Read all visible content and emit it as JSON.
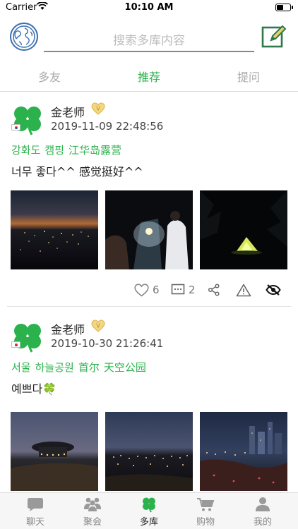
{
  "status_bar": {
    "carrier": "Carrier",
    "time": "10:10 AM"
  },
  "header": {
    "search_placeholder": "搜索多库内容"
  },
  "tabs": [
    {
      "label": "多友"
    },
    {
      "label": "推荐"
    },
    {
      "label": "提问"
    }
  ],
  "posts": [
    {
      "username": "金老师",
      "timestamp": "2019-11-09 22:48:56",
      "tags": [
        "강화도",
        "캠핑",
        "江华岛露营"
      ],
      "content": "너무 좋다^^ 感觉挺好^^",
      "likes": "6",
      "comments": "2"
    },
    {
      "username": "金老师",
      "timestamp": "2019-10-30 21:26:41",
      "tags": [
        "서울",
        "하늘공원",
        "首尔",
        "天空公园"
      ],
      "content": "예쁘다🍀"
    }
  ],
  "bottom_nav": [
    {
      "label": "聊天"
    },
    {
      "label": "聚会"
    },
    {
      "label": "多库"
    },
    {
      "label": "购物"
    },
    {
      "label": "我的"
    }
  ],
  "colors": {
    "accent": "#2bb24c",
    "muted": "#888888",
    "globe": "#3a6fb0",
    "badge": "#d9b24a"
  },
  "icons": {
    "globe": "globe-icon",
    "compose": "compose-icon",
    "like": "heart-icon",
    "comment": "comment-icon",
    "share": "share-icon",
    "report": "warning-icon",
    "hide": "eye-slash-icon"
  }
}
